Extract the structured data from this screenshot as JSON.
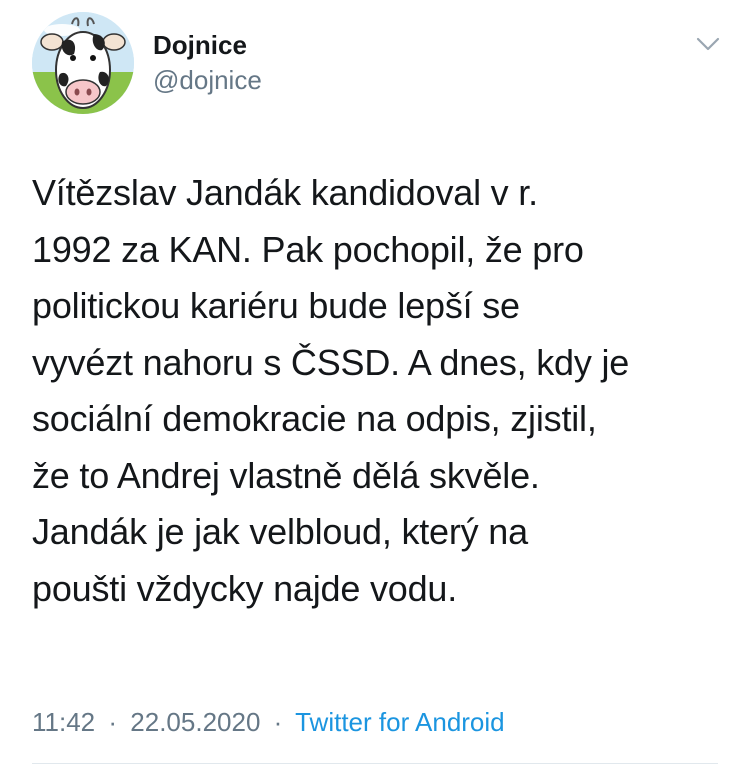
{
  "tweet": {
    "author": {
      "display_name": "Dojnice",
      "handle": "@dojnice",
      "avatar_icon": "cow-avatar-icon"
    },
    "menu_icon": "chevron-down-icon",
    "text": "Vítězslav Jandák kandidoval v r.\n1992 za KAN. Pak pochopil, že pro\npolitickou kariéru bude lepší se\nvyvézt nahoru s ČSSD. A dnes, kdy je\nsociální demokracie na odpis, zjistil,\nže to Andrej vlastně dělá skvěle.\nJandák je jak velbloud, který na\npoušti vždycky najde vodu.",
    "time": "11:42",
    "separator": "·",
    "date": "22.05.2020",
    "source": "Twitter for Android"
  },
  "colors": {
    "text_primary": "#14171a",
    "text_secondary": "#657786",
    "link": "#1b95e0",
    "divider": "#e1e8ed"
  }
}
